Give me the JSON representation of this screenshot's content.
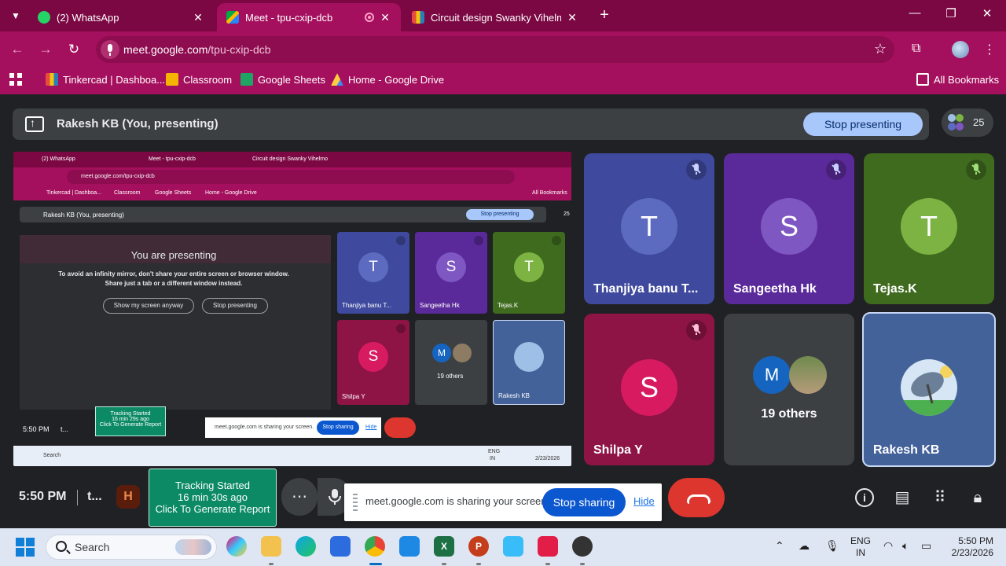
{
  "browser": {
    "tabs": [
      {
        "title": "(2) WhatsApp",
        "close": "✕"
      },
      {
        "title": "Meet - tpu-cxip-dcb",
        "close": "✕"
      },
      {
        "title": "Circuit design Swanky Vihelmo",
        "close": "✕"
      }
    ],
    "new_tab": "+",
    "url_host": "meet.google.com",
    "url_path": "/tpu-cxip-dcb",
    "bookmarks": [
      "Tinkercad | Dashboa...",
      "Classroom",
      "Google Sheets",
      "Home - Google Drive"
    ],
    "all_bookmarks": "All Bookmarks",
    "colors": {
      "tab_strip": "#7b0843",
      "toolbar": "#a5105e"
    }
  },
  "meet": {
    "presenting_label": "Rakesh KB (You, presenting)",
    "stop_presenting": "Stop presenting",
    "participant_count": "25",
    "you_are_presenting": "You are presenting",
    "mirror_warning_1": "To avoid an infinity mirror, don't share your entire screen or browser window.",
    "mirror_warning_2": "Share just a tab or a different window instead.",
    "show_screen_anyway": "Show my screen anyway",
    "stop_presenting_small": "Stop presenting",
    "tiles": [
      {
        "initial": "T",
        "name": "Thanjiya banu T...",
        "muted": true,
        "bg": "#3f4a9e",
        "avatar": "#5c6bc0"
      },
      {
        "initial": "S",
        "name": "Sangeetha Hk",
        "muted": true,
        "bg": "#5b2a9a",
        "avatar": "#7e57c2"
      },
      {
        "initial": "T",
        "name": "Tejas.K",
        "muted": true,
        "bg": "#3f6b1e",
        "avatar": "#7cb342"
      },
      {
        "initial": "S",
        "name": "Shilpa Y",
        "muted": true,
        "bg": "#8e1446",
        "avatar": "#d81b60"
      },
      {
        "initial": "M",
        "name": "19 others",
        "muted": false,
        "bg": "#3c4043",
        "avatar": "#1565c0"
      },
      {
        "initial": "",
        "name": "Rakesh KB",
        "muted": false,
        "bg": "#44629a",
        "avatar": "#9ec0e6"
      }
    ],
    "mini_names": [
      "Thanjiya banu T...",
      "Sangeetha Hk",
      "Tejas.K",
      "Shilpa Y",
      "19 others",
      "Rakesh KB"
    ],
    "mini_tabs": [
      "(2) WhatsApp",
      "Meet - tpu-cxip-dcb",
      "Circuit design Swanky Vihelmo"
    ],
    "mini_url": "meet.google.com/tpu-cxip-dcb",
    "mini_bookmarks": [
      "Tinkercad | Dashboa...",
      "Classroom",
      "Google Sheets",
      "Home - Google Drive",
      "All Bookmarks"
    ],
    "mini_clock": "5:50 PM",
    "mini_code": "t...",
    "mini_tracking": [
      "Tracking Started",
      "16 min 29s ago",
      "Click To Generate Report"
    ],
    "mini_notice": "meet.google.com is sharing your screen.",
    "mini_stop_sharing": "Stop sharing",
    "mini_hide": "Hide",
    "mini_search": "Search",
    "mini_lang": [
      "ENG",
      "IN"
    ],
    "mini_date": "2/23/2026"
  },
  "controls": {
    "clock": "5:50 PM",
    "meeting_code": "t...",
    "tracking_line1": "Tracking Started",
    "tracking_line2": "16 min 30s ago",
    "tracking_line3": "Click To Generate Report",
    "more": "⋮",
    "notice": "meet.google.com is sharing your screen.",
    "stop_sharing": "Stop sharing",
    "hide": "Hide"
  },
  "taskbar": {
    "search": "Search",
    "lang1": "ENG",
    "lang2": "IN",
    "time": "5:50 PM",
    "date": "2/23/2026"
  }
}
